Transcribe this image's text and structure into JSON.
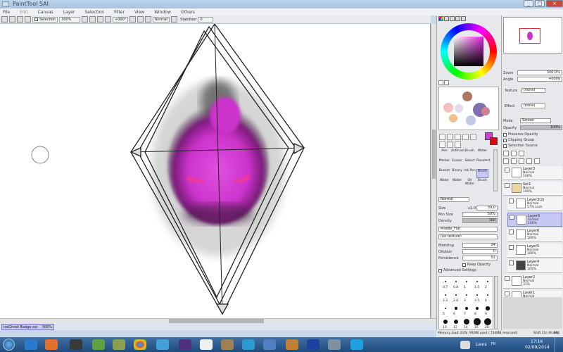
{
  "window": {
    "title": "PaintTool SAI",
    "controls": [
      "_",
      "□",
      "×"
    ]
  },
  "menu": [
    "File",
    "Edit",
    "Canvas",
    "Layer",
    "Selection",
    "Filter",
    "View",
    "Window",
    "Others"
  ],
  "toolbar": {
    "selection_label": "Selection",
    "zoom": "300%",
    "rotation": "+000°",
    "mode": "Normal",
    "stabilizer_label": "Stabilizer",
    "stabilizer_value": "0"
  },
  "document_tab": {
    "name": "IceGhost Badge.sai",
    "zoom": "300%"
  },
  "navigator": {
    "zoom_label": "Zoom",
    "zoom_value": "300.0%",
    "angle_label": "Angle",
    "angle_value": "+000$"
  },
  "layer_props": {
    "texture_label": "Texture",
    "texture_value": "(none)",
    "effect_label": "Effect",
    "effect_value": "(none)",
    "mode_label": "Mode",
    "mode_value": "Screen",
    "opacity_label": "Opacity",
    "opacity_value": "100%",
    "checkboxes": [
      "Preserve Opacity",
      "Clipping Group",
      "Selection Source"
    ]
  },
  "tools": {
    "brushes": [
      [
        "Pen",
        "AirBrush",
        "Brush",
        "Water"
      ],
      [
        "Marker",
        "Eraser",
        "Select",
        "Deselect"
      ],
      [
        "Bucket",
        "Binary",
        "Ink Pen",
        "Brush"
      ],
      [
        "Water",
        "Water",
        "Oil Water",
        "Brush"
      ]
    ],
    "blend_mode": "Normal",
    "size_label": "Size",
    "size_mult": "x1.0",
    "size_value": "39.0",
    "min_size_label": "Min Size",
    "min_size_value": "50%",
    "density_label": "Density",
    "density_value": "100",
    "shape_value": "Middle_Flat",
    "texture_value": "(no texture)",
    "blending_label": "Blending",
    "blending_value": "24",
    "dilution_label": "Dilution",
    "dilution_value": "0",
    "persistence_label": "Persistence",
    "persistence_value": "51",
    "keep_opacity": "Keep Opacity",
    "advanced": "Advanced Settings",
    "size_presets": [
      "0.7",
      "0.8",
      "1",
      "1.5",
      "2",
      "2.3",
      "2.6",
      "3",
      "3.5",
      "4",
      "5",
      "6",
      "7",
      "8",
      "9",
      "10",
      "12",
      "14",
      "16",
      "20"
    ]
  },
  "layers": [
    {
      "name": "Layer3",
      "mode": "Normal",
      "opacity": "100%"
    },
    {
      "name": "Set1",
      "mode": "Normal",
      "opacity": "100%"
    },
    {
      "name": "Layer3(2)",
      "mode": "Normal",
      "opacity": "57% Lock"
    },
    {
      "name": "Layer6",
      "mode": "Screen",
      "opacity": "100%"
    },
    {
      "name": "Layer6",
      "mode": "Normal",
      "opacity": "100%"
    },
    {
      "name": "Layer5",
      "mode": "Normal",
      "opacity": "100%"
    },
    {
      "name": "Layer4",
      "mode": "Normal",
      "opacity": "100%"
    },
    {
      "name": "Layer2",
      "mode": "Normal",
      "opacity": "31%"
    },
    {
      "name": "Layer1",
      "mode": "Normal",
      "opacity": "30%"
    }
  ],
  "status": {
    "memory": "Memory load: 63% (91MB used / 734MB reserved)",
    "keys": "Shift Ctrl Alt SPC",
    "any": "Any"
  },
  "taskbar": {
    "lang": "Liens",
    "keyboard": "FR",
    "time": "17:16",
    "date": "02/09/2014"
  },
  "colors": {
    "primary": "#d040d0",
    "secondary": "#d01010",
    "ghost": "#cc33cc",
    "eyes": "#ff3b7a"
  }
}
